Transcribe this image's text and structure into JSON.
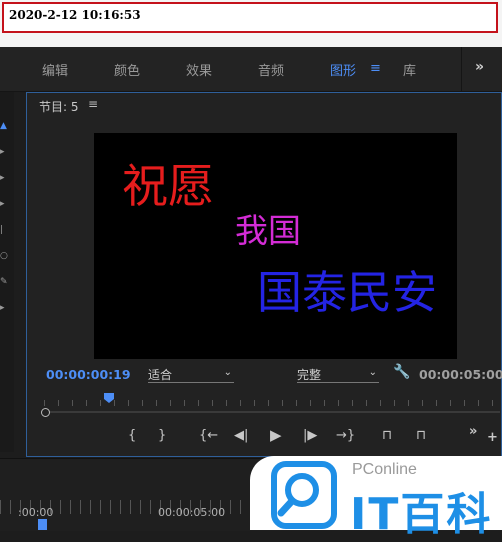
{
  "timestamp": "2020-2-12 10:16:53",
  "tabs": [
    {
      "label": "编辑",
      "active": false
    },
    {
      "label": "颜色",
      "active": false
    },
    {
      "label": "效果",
      "active": false
    },
    {
      "label": "音频",
      "active": false
    },
    {
      "label": "图形",
      "active": true
    },
    {
      "label": "库",
      "active": false
    }
  ],
  "tab_menu_icon": "≡",
  "more_icon": "»",
  "monitor": {
    "title": "节目: 5",
    "menu_icon": "≡",
    "text_lines": [
      {
        "text": "祝愿",
        "color": "#e61d1d"
      },
      {
        "text": "我国",
        "color": "#d42cd6"
      },
      {
        "text": "国泰民安",
        "color": "#2424e4"
      }
    ],
    "current_timecode": "00:00:00:19",
    "fit_label": "适合",
    "quality_label": "完整",
    "total_timecode": "00:00:05:00",
    "transport": {
      "mark_in": "{",
      "mark_out": "}",
      "go_in": "{←",
      "step_back": "◀|",
      "play": "▶",
      "step_fwd": "|▶",
      "go_out": "→}",
      "lift": "⊓",
      "extract": "⊓",
      "more": "»",
      "add": "+"
    }
  },
  "timeline": {
    "label_start": ":00:00",
    "label_mid": "00:00:05:00"
  },
  "watermark": {
    "brand": "PConline",
    "name": "IT百科"
  },
  "colors": {
    "accent": "#4d8ef6",
    "stamp_border": "#c4121b"
  }
}
